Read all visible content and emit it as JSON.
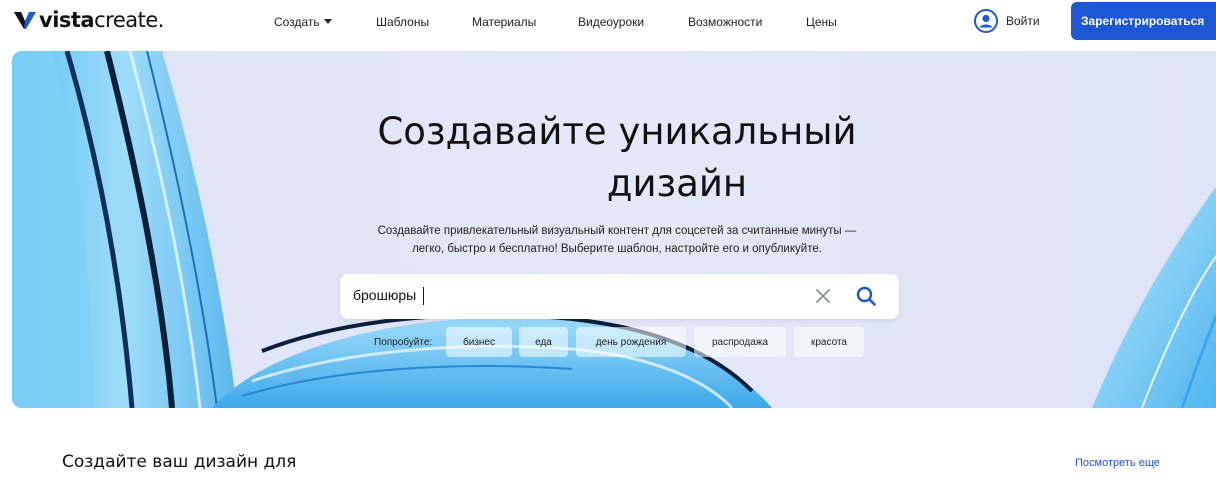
{
  "header": {
    "logo": {
      "bold": "vista",
      "light": "create",
      "dot": "."
    },
    "nav": [
      {
        "label": "Создать",
        "has_caret": true
      },
      {
        "label": "Шаблоны"
      },
      {
        "label": "Материалы"
      },
      {
        "label": "Видеоуроки"
      },
      {
        "label": "Возможности"
      },
      {
        "label": "Цены"
      }
    ],
    "login_label": "Войти",
    "signup_label": "Зарегистрироваться"
  },
  "hero": {
    "title_line1": "Создавайте уникальный",
    "title_line2": "дизайн",
    "subtitle_line1": "Создавайте привлекательный визуальный контент для соцсетей за считанные минуты —",
    "subtitle_line2": "легко, быстро и бесплатно! Выберите шаблон, настройте его и опубликуйте.",
    "search_value": "брошюры",
    "try_label": "Попробуйте:",
    "chips": [
      "бизнес",
      "еда",
      "день рождения",
      "распродажа",
      "красота"
    ]
  },
  "section": {
    "title": "Создайте ваш дизайн для",
    "see_more": "Посмотреть еще"
  },
  "colors": {
    "brand_blue": "#1e57d6",
    "hero_bg": "#e2e6f7",
    "ribbon_light": "#8fd3f7",
    "ribbon_dark": "#1f8fe0"
  },
  "icons": [
    "logo-check-icon",
    "user-circle-icon",
    "close-icon",
    "search-icon",
    "caret-down-icon"
  ]
}
